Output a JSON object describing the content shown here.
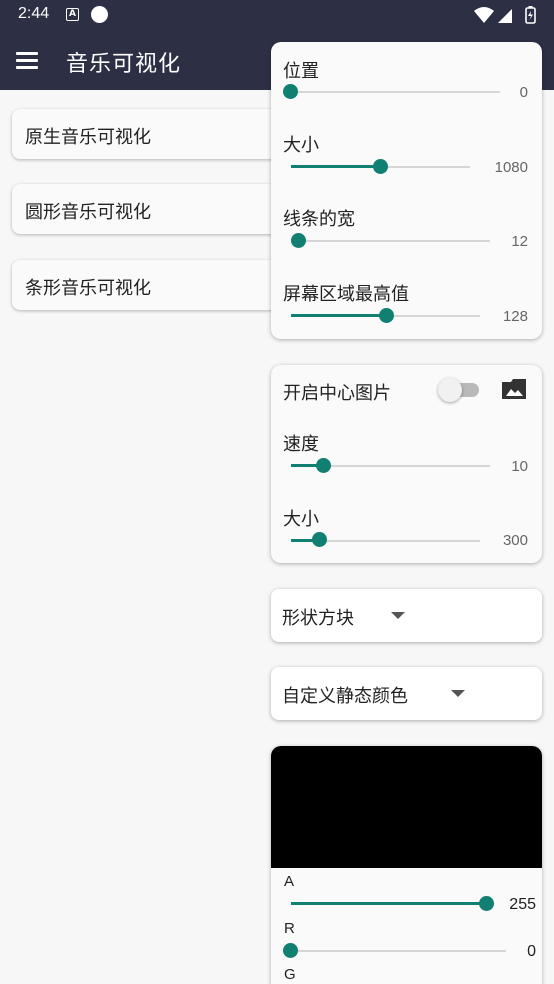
{
  "status_bar": {
    "time": "2:44",
    "a_badge": "A"
  },
  "app_bar": {
    "title": "音乐可视化"
  },
  "visualizers": [
    {
      "label": "原生音乐可视化"
    },
    {
      "label": "圆形音乐可视化"
    },
    {
      "label": "条形音乐可视化"
    }
  ],
  "bar_settings": {
    "sliders": [
      {
        "label": "位置",
        "value": "0",
        "fraction": 0.0
      },
      {
        "label": "大小",
        "value": "1080",
        "fraction": 0.5
      },
      {
        "label": "线条的宽",
        "value": "12",
        "fraction": 0.04
      },
      {
        "label": "屏幕区域最高值",
        "value": "128",
        "fraction": 0.5
      }
    ]
  },
  "center_image": {
    "toggle_label": "开启中心图片",
    "toggle_on": false,
    "sliders": [
      {
        "label": "速度",
        "value": "10",
        "fraction": 0.17
      },
      {
        "label": "大小",
        "value": "300",
        "fraction": 0.15
      }
    ]
  },
  "shape_dropdown": {
    "selected": "形状方块"
  },
  "color_mode_dropdown": {
    "selected": "自定义静态颜色"
  },
  "color_picker": {
    "preview_color": "#000000",
    "channels": [
      {
        "label": "A",
        "value": "255",
        "fraction": 1.0
      },
      {
        "label": "R",
        "value": "0",
        "fraction": 0.0
      },
      {
        "label": "G",
        "value": "",
        "fraction": 0.0
      }
    ]
  },
  "colors": {
    "accent": "#127f73",
    "bar": "#2d2f45"
  }
}
